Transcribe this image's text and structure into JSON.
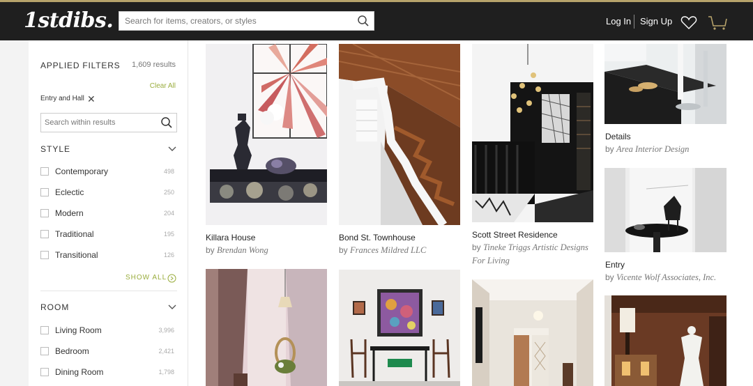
{
  "header": {
    "logo": "1stdibs.",
    "search_placeholder": "Search for items, creators, or styles",
    "login": "Log In",
    "signup": "Sign Up"
  },
  "filters": {
    "title": "APPLIED FILTERS",
    "results": "1,609 results",
    "clear_all": "Clear All",
    "applied": "Entry and Hall",
    "search_placeholder": "Search within results",
    "style": {
      "title": "STYLE",
      "options": [
        {
          "label": "Contemporary",
          "count": "498"
        },
        {
          "label": "Eclectic",
          "count": "250"
        },
        {
          "label": "Modern",
          "count": "204"
        },
        {
          "label": "Traditional",
          "count": "195"
        },
        {
          "label": "Transitional",
          "count": "126"
        }
      ],
      "show_all": "SHOW ALL"
    },
    "room": {
      "title": "ROOM",
      "options": [
        {
          "label": "Living Room",
          "count": "3,996"
        },
        {
          "label": "Bedroom",
          "count": "2,421"
        },
        {
          "label": "Dining Room",
          "count": "1,798"
        }
      ]
    }
  },
  "cards": [
    {
      "title": "Killara House",
      "by": "by",
      "designer": "Brendan Wong"
    },
    {
      "title": "Bond St. Townhouse",
      "by": "by",
      "designer": "Frances Mildred LLC"
    },
    {
      "title": "Scott Street Residence",
      "by": "by",
      "designer": "Tineke Triggs Artistic Designs",
      "designer2": "For Living"
    },
    {
      "title": "Details",
      "by": "by",
      "designer": "Area Interior Design"
    },
    {
      "title": "Entry",
      "by": "by",
      "designer": "Vicente Wolf Associates, Inc."
    }
  ],
  "colors": {
    "header_bg": "#1f1f1f",
    "accent_gold": "#b7a36b",
    "accent_green": "#9aad3e"
  }
}
